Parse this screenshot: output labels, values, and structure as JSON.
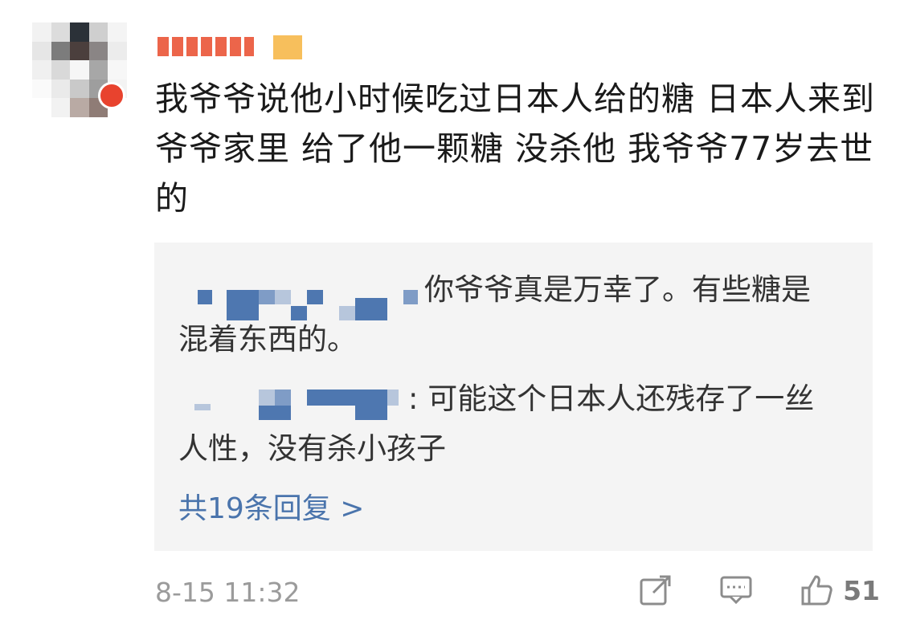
{
  "comment": {
    "text": "我爷爷说他小时候吃过日本人给的糖 日本人来到爷爷家里 给了他一颗糖 没杀他 我爷爷77岁去世的"
  },
  "replies": [
    {
      "text": "你爷爷真是万幸了。有些糖是混着东西的。"
    },
    {
      "text": ": 可能这个日本人还残存了一丝人性，没有杀小孩子"
    }
  ],
  "more_replies_label": "共19条回复 >",
  "timestamp": "8-15 11:32",
  "like_count": "51",
  "icons": {
    "share": "share-icon",
    "comment": "comment-icon",
    "like": "thumbs-up-icon"
  },
  "colors": {
    "link_blue": "#4a74ac",
    "text": "#1a1a1a",
    "reply_bg": "#f4f4f4",
    "meta_gray": "#9b9b9b",
    "badge_red": "#e8432e"
  }
}
